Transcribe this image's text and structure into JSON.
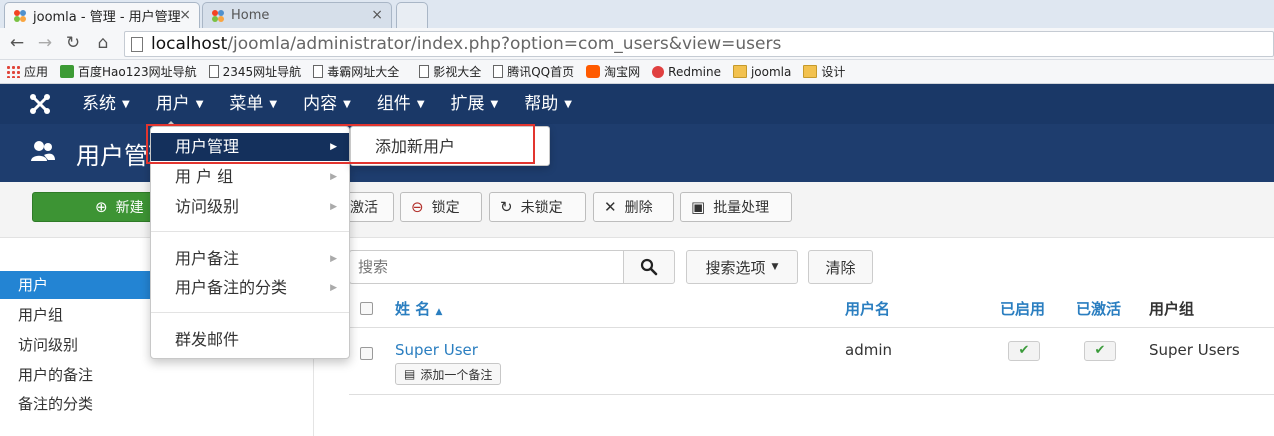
{
  "browser": {
    "tabs": [
      {
        "title": "joomla - 管理 - 用户管理",
        "close": "×"
      },
      {
        "title": "Home",
        "close": "×"
      }
    ],
    "url_host": "localhost",
    "url_rest": "/joomla/administrator/index.php?option=com_users&view=users",
    "bookmarks": [
      "应用",
      "百度Hao123网址导航",
      "2345网址导航",
      "毒霸网址大全",
      "影视大全",
      "腾讯QQ首页",
      "淘宝网",
      "Redmine",
      "joomla",
      "设计"
    ]
  },
  "nav": {
    "items": [
      "系统",
      "用户",
      "菜单",
      "内容",
      "组件",
      "扩展",
      "帮助"
    ]
  },
  "header": {
    "title": "用户管理"
  },
  "toolbar": {
    "new": "新建",
    "activate": "激活",
    "lock": "锁定",
    "unlock": "未锁定",
    "delete": "删除",
    "batch": "批量处理"
  },
  "sidebar": {
    "items": [
      "用户",
      "用户组",
      "访问级别",
      "用户的备注",
      "备注的分类"
    ]
  },
  "filter": {
    "search_placeholder": "搜索",
    "search_options": "搜索选项",
    "clear": "清除"
  },
  "table": {
    "headers": {
      "name": "姓 名",
      "username": "用户名",
      "enabled": "已启用",
      "activated": "已激活",
      "groups": "用户组"
    },
    "rows": [
      {
        "name": "Super User",
        "note_button": "添加一个备注",
        "username": "admin",
        "groups": "Super Users"
      }
    ]
  },
  "dropdown": {
    "items": [
      "用户管理",
      "用 户 组",
      "访问级别",
      "用户备注",
      "用户备注的分类",
      "群发邮件"
    ],
    "submenu": [
      "添加新用户"
    ]
  },
  "colors": {
    "nav_bg": "#1a3867",
    "header_bg": "#1e3d6e",
    "accent_blue": "#2384d3",
    "new_button_green": "#3d9434",
    "highlight_box": "#e2352f"
  }
}
